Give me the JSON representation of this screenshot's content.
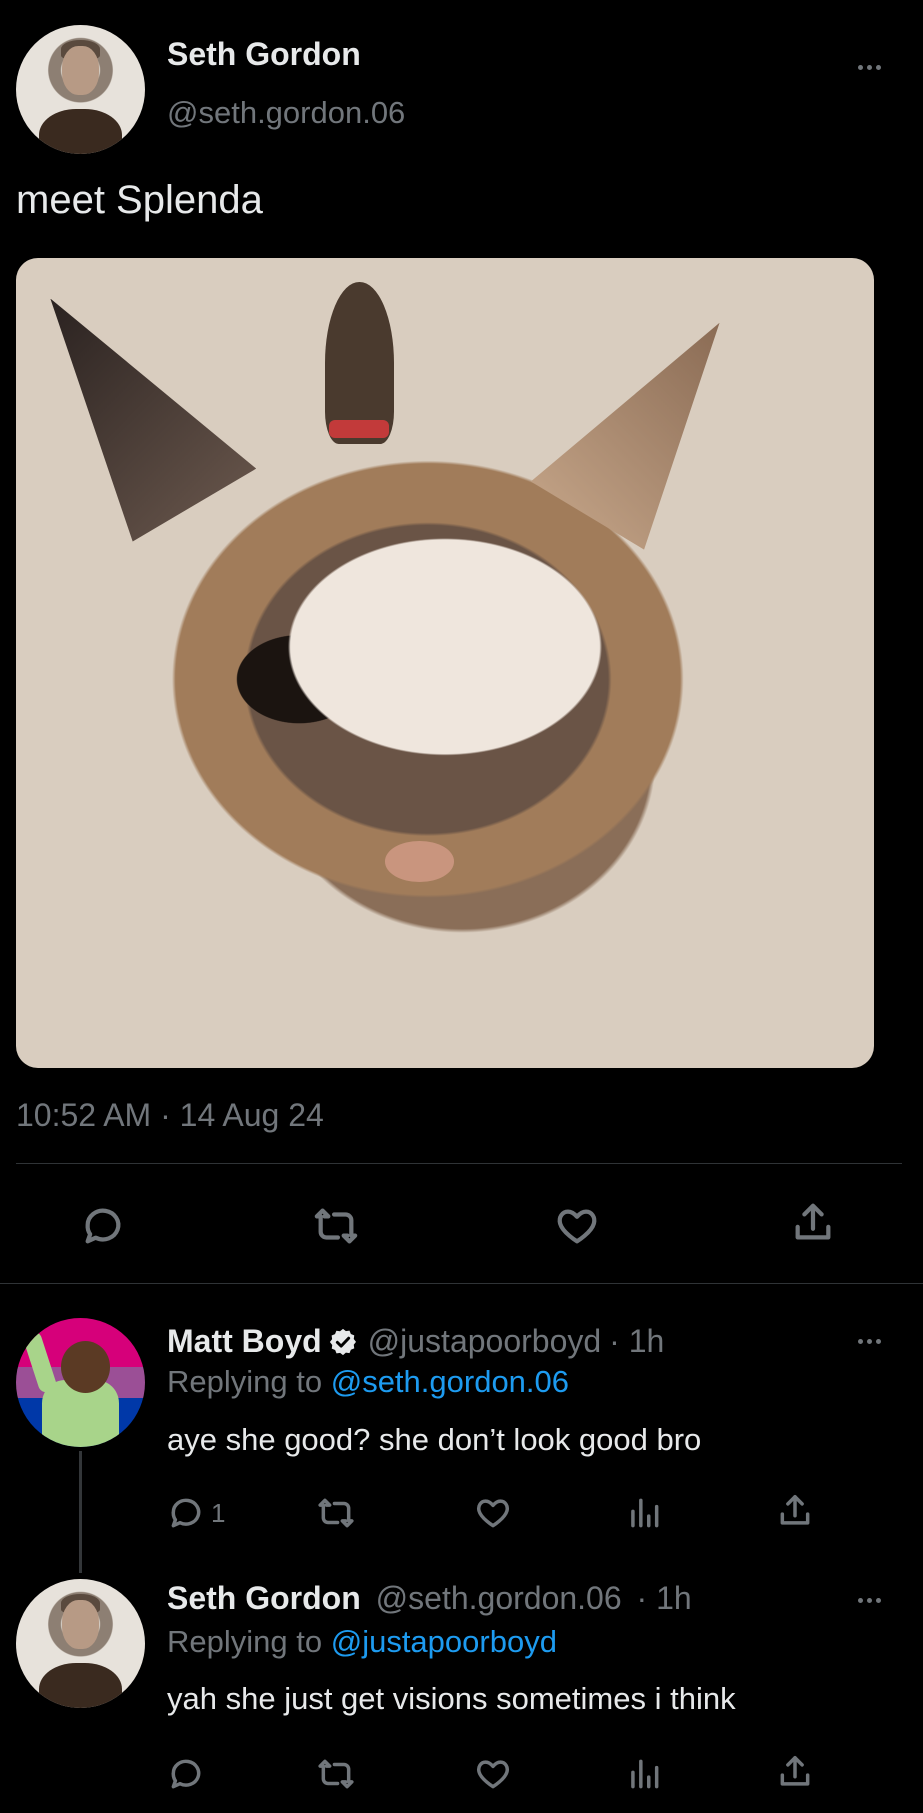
{
  "main_tweet": {
    "author_name": "Seth Gordon",
    "handle": "@seth.gordon.06",
    "text": "meet Splenda",
    "timestamp": "10:52 AM · 14 Aug 24"
  },
  "replies": [
    {
      "author_name": "Matt Boyd",
      "verified": true,
      "handle": "@justapoorboyd",
      "time": "· 1h",
      "replying_label": "Replying to",
      "replying_to": "@seth.gordon.06",
      "text": "aye she good? she don’t look good bro",
      "reply_count": "1"
    },
    {
      "author_name": "Seth Gordon",
      "handle": "@seth.gordon.06",
      "time": "· 1h",
      "replying_label": "Replying to",
      "replying_to": "@justapoorboyd",
      "text": "yah she just get visions sometimes i think"
    }
  ],
  "icons": {
    "reply": "reply-icon",
    "retweet": "retweet-icon",
    "like": "heart-icon",
    "views": "views-icon",
    "share": "share-icon",
    "more": "more-icon",
    "verified": "verified-badge-icon"
  },
  "colors": {
    "background": "#000000",
    "text": "#e7e9ea",
    "muted": "#71767b",
    "link": "#1d9bf0",
    "divider": "#2f3336"
  }
}
